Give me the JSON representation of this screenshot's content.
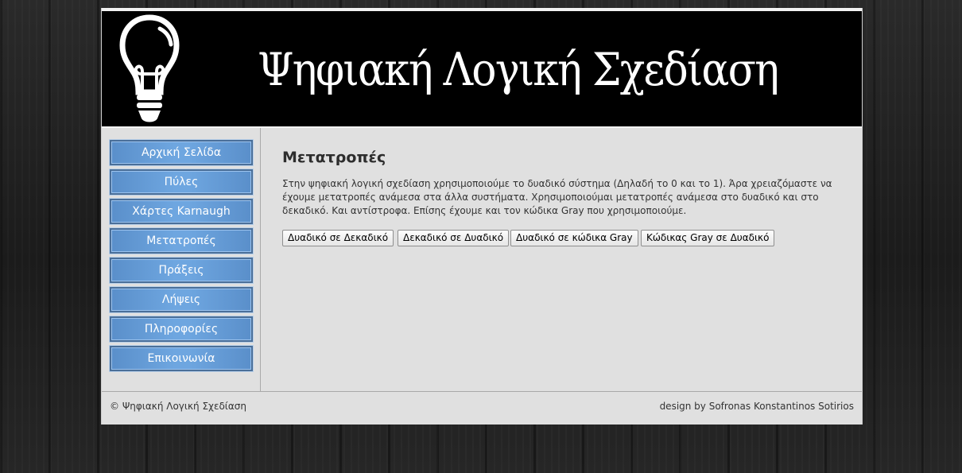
{
  "header": {
    "title": "Ψηφιακή Λογική Σχεδίαση",
    "logo_icon": "lightbulb-icon"
  },
  "sidebar": {
    "items": [
      {
        "label": "Αρχική Σελίδα"
      },
      {
        "label": "Πύλες"
      },
      {
        "label": "Χάρτες Karnaugh"
      },
      {
        "label": "Μετατροπές"
      },
      {
        "label": "Πράξεις"
      },
      {
        "label": "Λήψεις"
      },
      {
        "label": "Πληροφορίες"
      },
      {
        "label": "Επικοινωνία"
      }
    ]
  },
  "main": {
    "heading": "Μετατροπές",
    "intro": "Στην ψηφιακή λογική σχεδίαση χρησιμοποιούμε το δυαδικό σύστημα (Δηλαδή το 0 και το 1). Άρα χρειαζόμαστε να έχουμε μετατροπές ανάμεσα στα άλλα συστήματα. Χρησιμοποιούμαι μετατροπές ανάμεσα στο δυαδικό και στο δεκαδικό. Και αντίστροφα. Επίσης έχουμε και τον κώδικα Gray που χρησιμοποιούμε.",
    "buttons": [
      {
        "label": "Δυαδικό σε Δεκαδικό"
      },
      {
        "label": "Δεκαδικό σε Δυαδικό"
      },
      {
        "label": "Δυαδικό σε κώδικα Gray"
      },
      {
        "label": "Κώδικας Gray σε Δυαδικό"
      }
    ]
  },
  "footer": {
    "copyright": "© Ψηφιακή Λογική Σχεδίαση",
    "credit": "design by Sofronas Konstantinos Sotirios"
  },
  "colors": {
    "header_bg": "#000000",
    "content_bg": "#e0e0e0",
    "nav_button": "#6ea6e0",
    "nav_border": "#4a6f99",
    "page_bg": "#1e1e1e"
  }
}
